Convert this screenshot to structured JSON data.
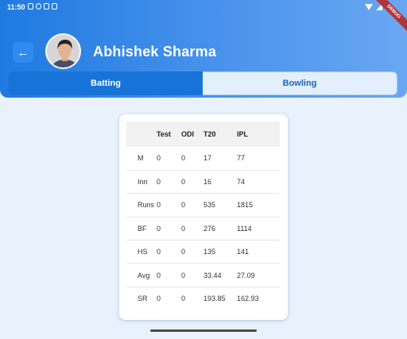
{
  "status_bar": {
    "time": "11:50",
    "debug_label": "DEBUG"
  },
  "header": {
    "player_name": "Abhishek Sharma",
    "back_icon": "arrow-left-icon"
  },
  "tabs": [
    {
      "label": "Batting",
      "active": true
    },
    {
      "label": "Bowling",
      "active": false
    }
  ],
  "stats": {
    "columns": [
      "",
      "Test",
      "ODI",
      "T20",
      "IPL"
    ],
    "rows": [
      [
        "M",
        "0",
        "0",
        "17",
        "77"
      ],
      [
        "Inn",
        "0",
        "0",
        "16",
        "74"
      ],
      [
        "Runs",
        "0",
        "0",
        "535",
        "1815"
      ],
      [
        "BF",
        "0",
        "0",
        "276",
        "1114"
      ],
      [
        "HS",
        "0",
        "0",
        "135",
        "141"
      ],
      [
        "Avg",
        "0",
        "0",
        "33.44",
        "27.09"
      ],
      [
        "SR",
        "0",
        "0",
        "193.85",
        "162.93"
      ]
    ]
  },
  "colors": {
    "header_start": "#1f7ae0",
    "header_end": "#6aa7f2",
    "tab_active": "#1873d8",
    "tab_inactive": "#e3effd",
    "page_background": "#e8f1fc"
  }
}
